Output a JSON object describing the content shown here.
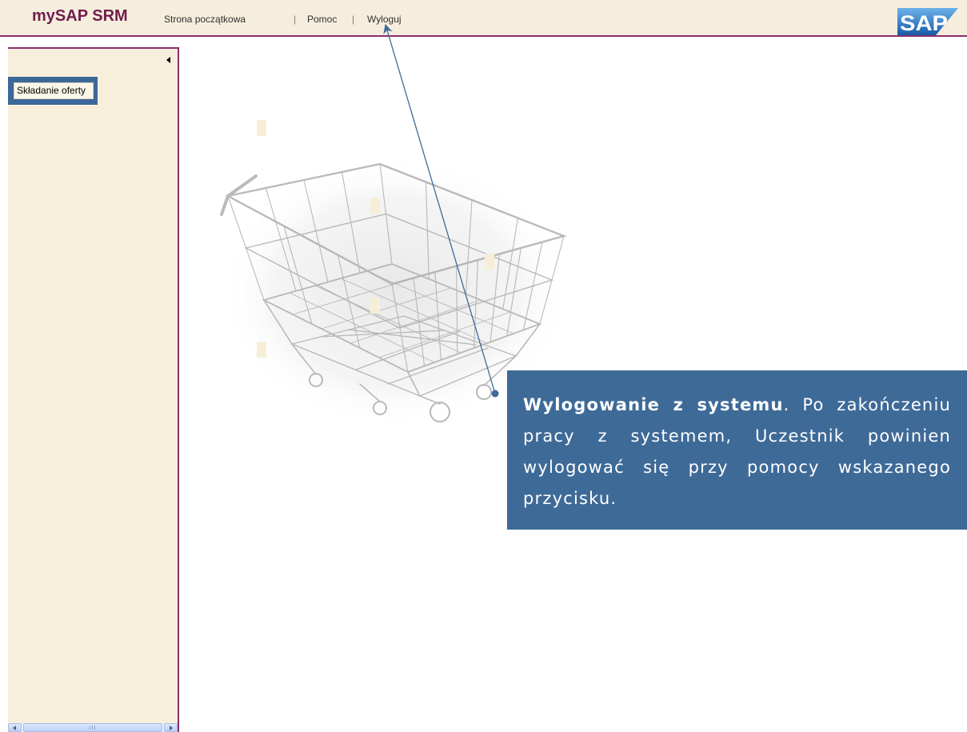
{
  "app": {
    "title": "mySAP SRM",
    "logo_text": "SAP"
  },
  "header": {
    "nav": [
      {
        "label": "Strona początkowa"
      },
      {
        "label": "Pomoc"
      },
      {
        "label": "Wyloguj"
      }
    ],
    "separator": "|"
  },
  "sidebar": {
    "items": [
      {
        "label": "Składanie oferty",
        "highlighted": true
      }
    ]
  },
  "callout": {
    "title": "Wylogowanie z systemu",
    "body": ". Po zakończeniu pracy z systemem, Uczestnik powinien wylogować się przy pomocy wskazanego przycisku."
  },
  "icons": {
    "collapse": "triangle-left-icon",
    "scroll_left": "arrow-left-icon",
    "scroll_right": "arrow-right-icon",
    "scroll_grip": "grip-icon"
  },
  "colors": {
    "header_bg": "#f6eedc",
    "brand": "#6f1d4f",
    "frame": "#8b2d6b",
    "sidebar_bg": "#f7eedb",
    "highlight": "#3c6899",
    "callout_bg": "#3e6a98",
    "callout_text": "#ffffff",
    "arrow": "#3d6a98"
  }
}
